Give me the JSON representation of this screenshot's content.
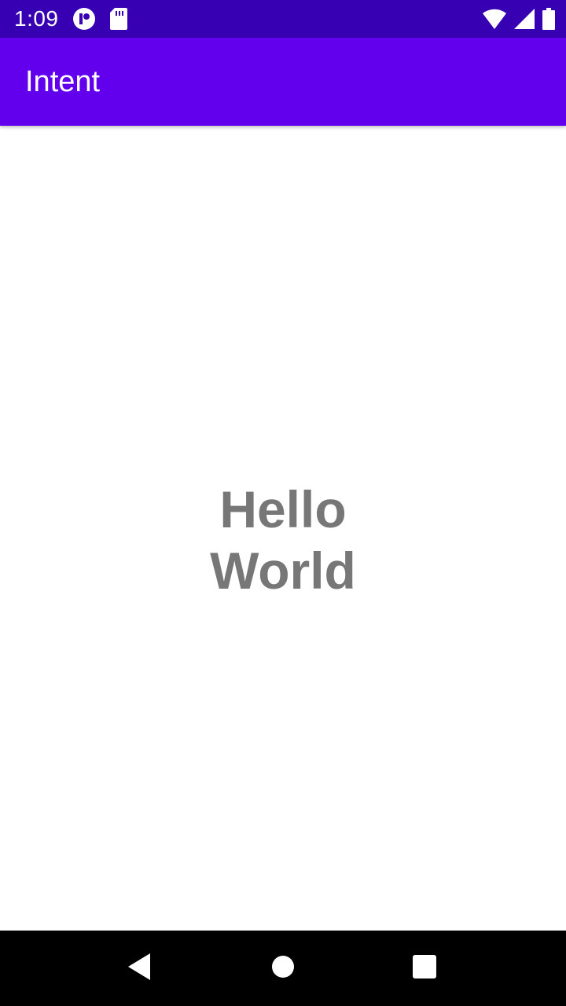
{
  "status_bar": {
    "time": "1:09",
    "icons": [
      "notification-app-icon",
      "sd-card-icon",
      "wifi-icon",
      "cell-signal-icon",
      "battery-icon"
    ],
    "background": "#3700b3"
  },
  "app_bar": {
    "title": "Intent",
    "background": "#6200ee"
  },
  "main": {
    "text": "Hello World",
    "text_color": "#777777"
  },
  "nav_bar": {
    "buttons": [
      "back-icon",
      "home-icon",
      "recents-icon"
    ],
    "background": "#000000"
  }
}
